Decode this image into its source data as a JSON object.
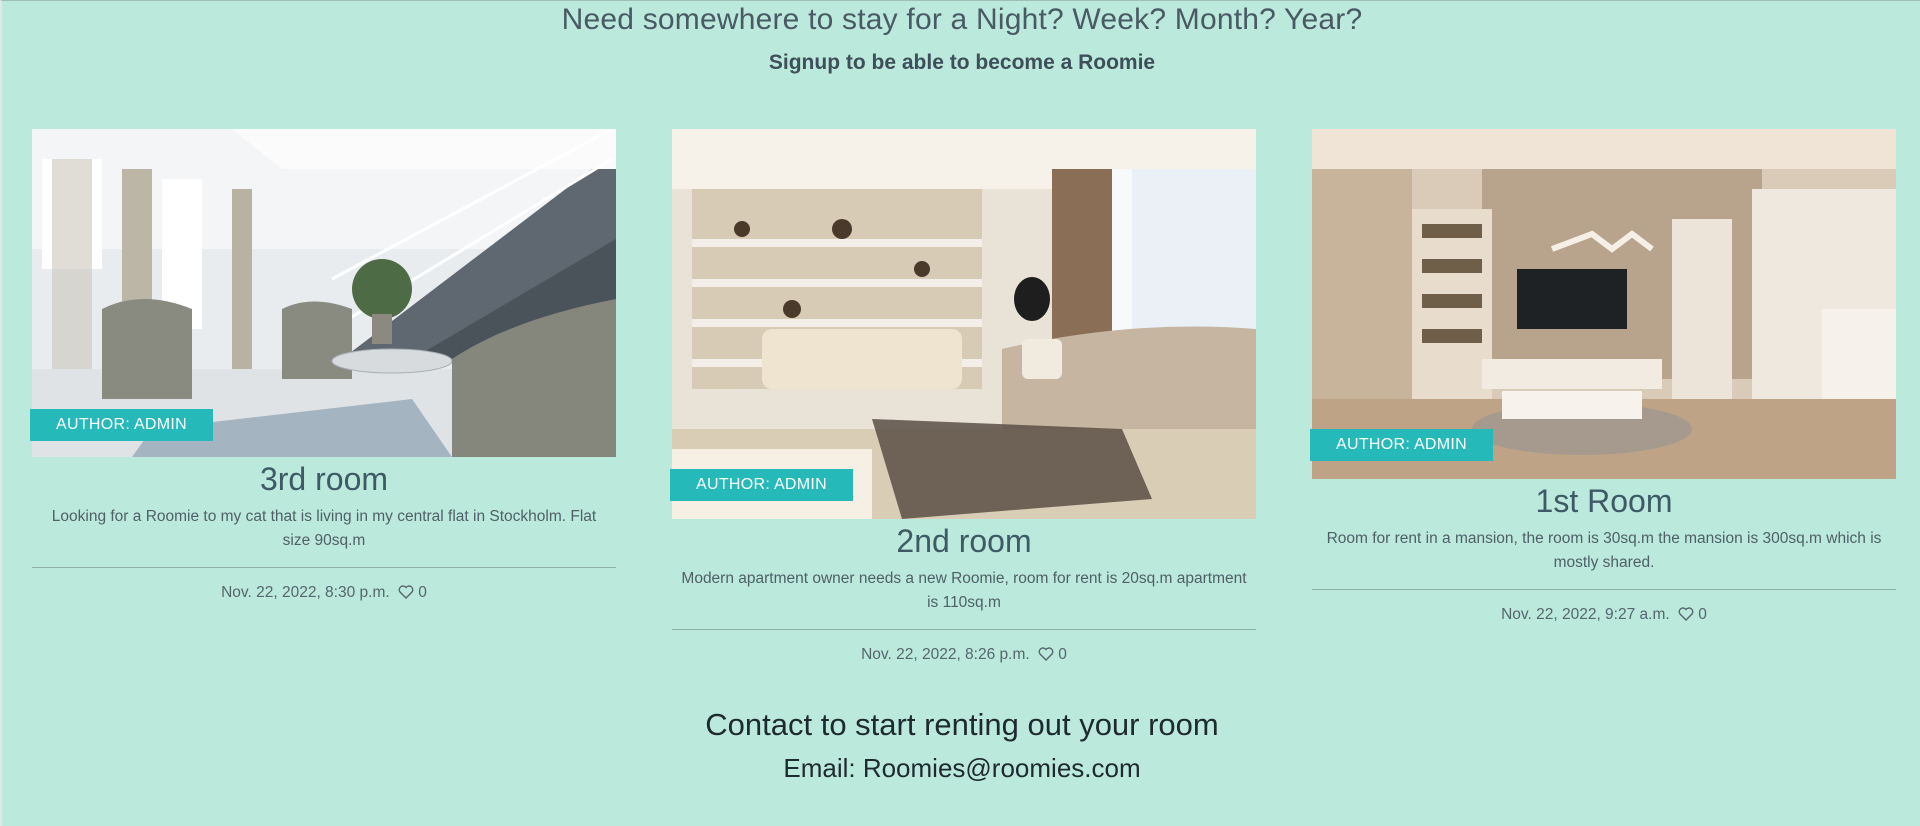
{
  "hero": {
    "title": "Need somewhere to stay for a Night? Week? Month? Year?",
    "subtitle": "Signup to be able to become a Roomie"
  },
  "cards": [
    {
      "author": "AUTHOR: ADMIN",
      "title": "3rd room",
      "description": "Looking for a Roomie to my cat that is living in my central flat in Stockholm. Flat size 90sq.m",
      "date": "Nov. 22, 2022, 8:30 p.m.",
      "likes": "0",
      "image_icon": "living-room-staircase-photo"
    },
    {
      "author": "AUTHOR: ADMIN",
      "title": "2nd room",
      "description": "Modern apartment owner needs a new Roomie, room for rent is 20sq.m apartment is 110sq.m",
      "date": "Nov. 22, 2022, 8:26 p.m.",
      "likes": "0",
      "image_icon": "living-room-sofa-photo"
    },
    {
      "author": "AUTHOR: ADMIN",
      "title": "1st Room",
      "description": "Room for rent in a mansion, the room is 30sq.m the mansion is 300sq.m which is mostly shared.",
      "date": "Nov. 22, 2022, 9:27 a.m.",
      "likes": "0",
      "image_icon": "living-room-tv-photo"
    }
  ],
  "contact": {
    "title": "Contact to start renting out your room",
    "email": "Email: Roomies@roomies.com"
  },
  "colors": {
    "background": "#bbe9db",
    "author_tag": "#25b9b9",
    "text_dark": "#1f2a30"
  }
}
